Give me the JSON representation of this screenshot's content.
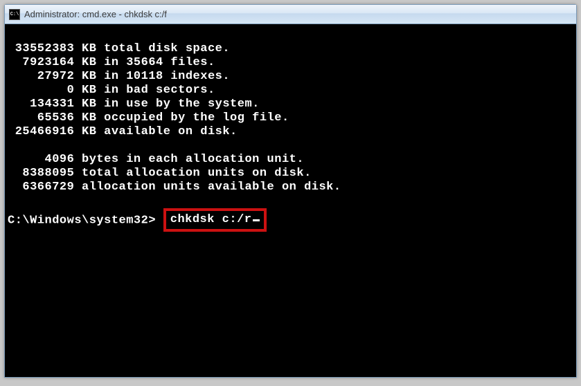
{
  "titlebar": {
    "icon_label": "C:\\",
    "title": "Administrator: cmd.exe - chkdsk  c:/f"
  },
  "terminal": {
    "lines": [
      "",
      " 33552383 KB total disk space.",
      "  7923164 KB in 35664 files.",
      "    27972 KB in 10118 indexes.",
      "        0 KB in bad sectors.",
      "   134331 KB in use by the system.",
      "    65536 KB occupied by the log file.",
      " 25466916 KB available on disk.",
      "",
      "     4096 bytes in each allocation unit.",
      "  8388095 total allocation units on disk.",
      "  6366729 allocation units available on disk."
    ],
    "prompt": "C:\\Windows\\system32>",
    "command": "chkdsk c:/r"
  }
}
